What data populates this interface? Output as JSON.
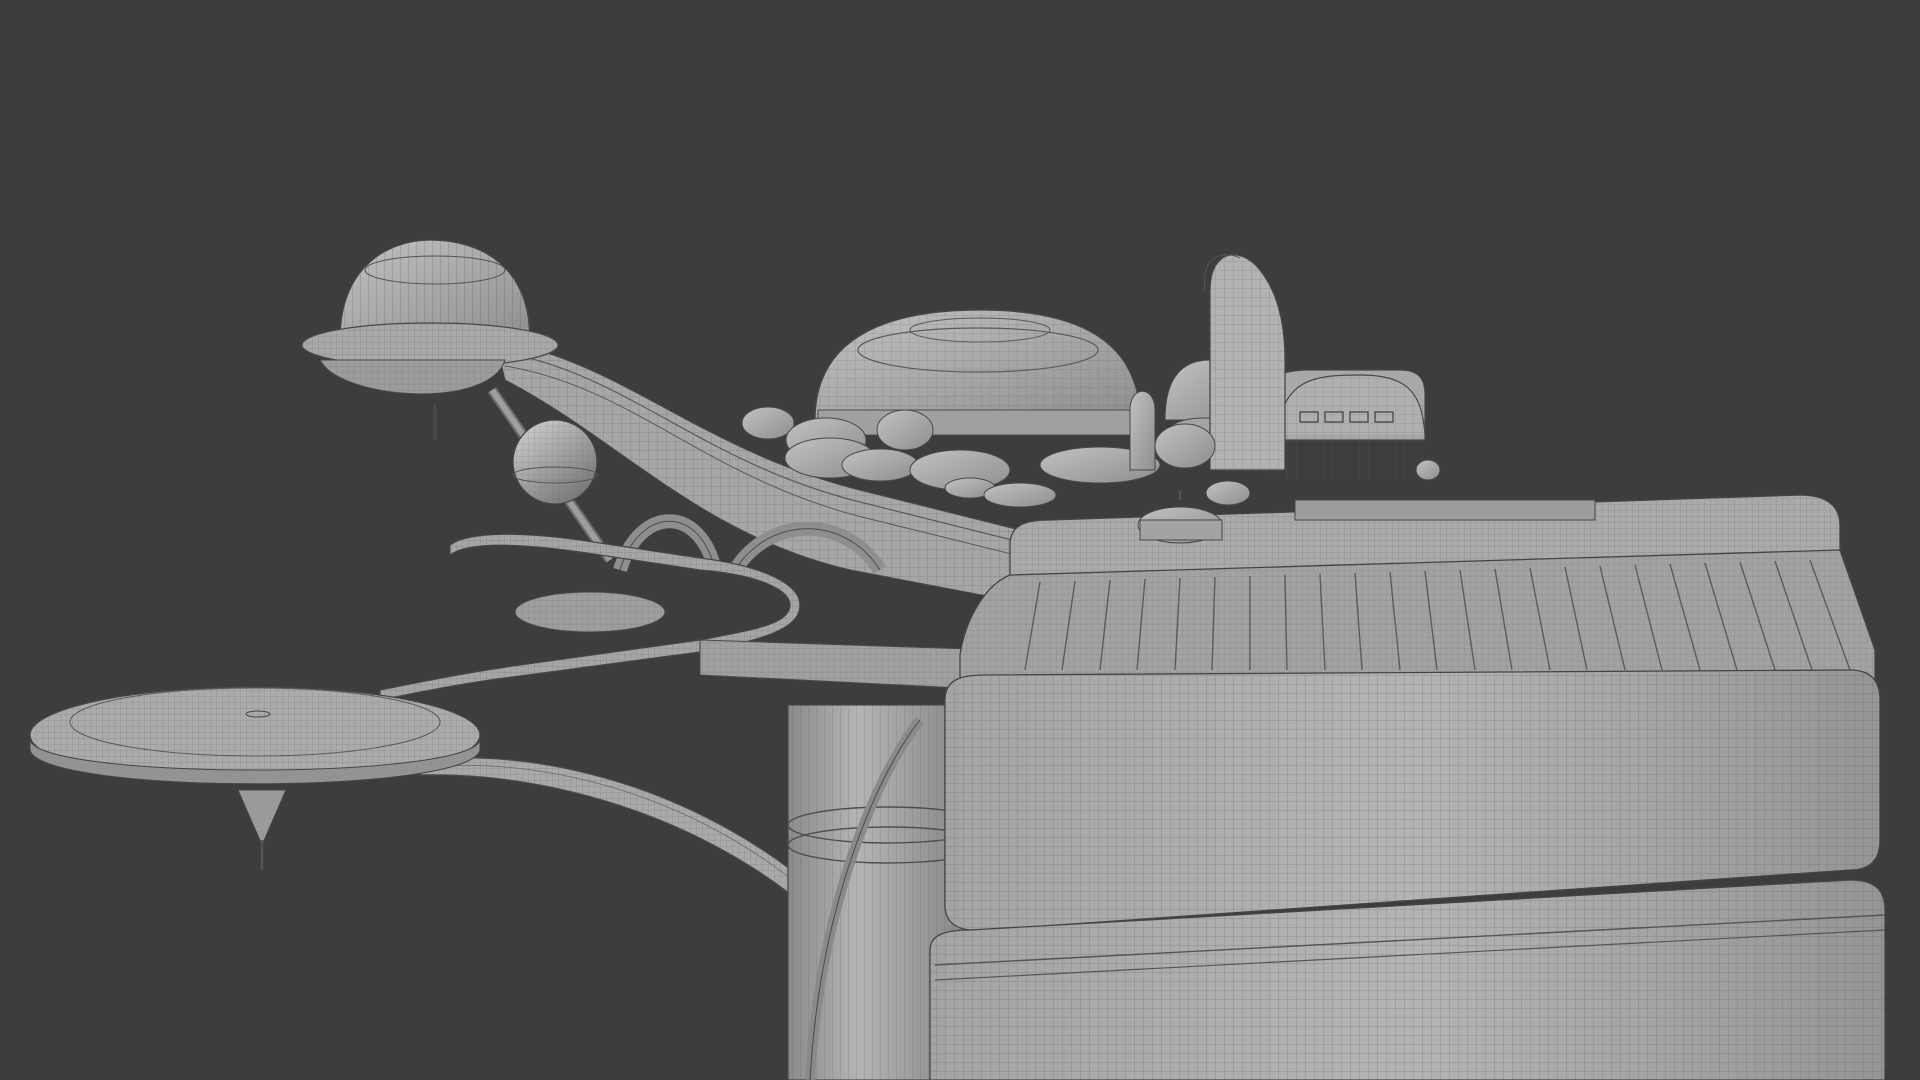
{
  "viewport": {
    "background_color": "#3d3d3d",
    "shading": "solid-gray-with-wireframe-overlay",
    "model_color": "#a8a8a8",
    "wire_color": "#4a4a4a"
  },
  "scene": {
    "objects": [
      "dome-pod-left",
      "curved-skybridge",
      "central-dome",
      "curved-tower-pipe",
      "right-dome-building",
      "small-domes-cluster",
      "sphere-pod",
      "arched-walkway",
      "winding-walkway",
      "landing-platform",
      "sweeping-arc-support",
      "cylindrical-tower",
      "large-rounded-block-building"
    ]
  }
}
